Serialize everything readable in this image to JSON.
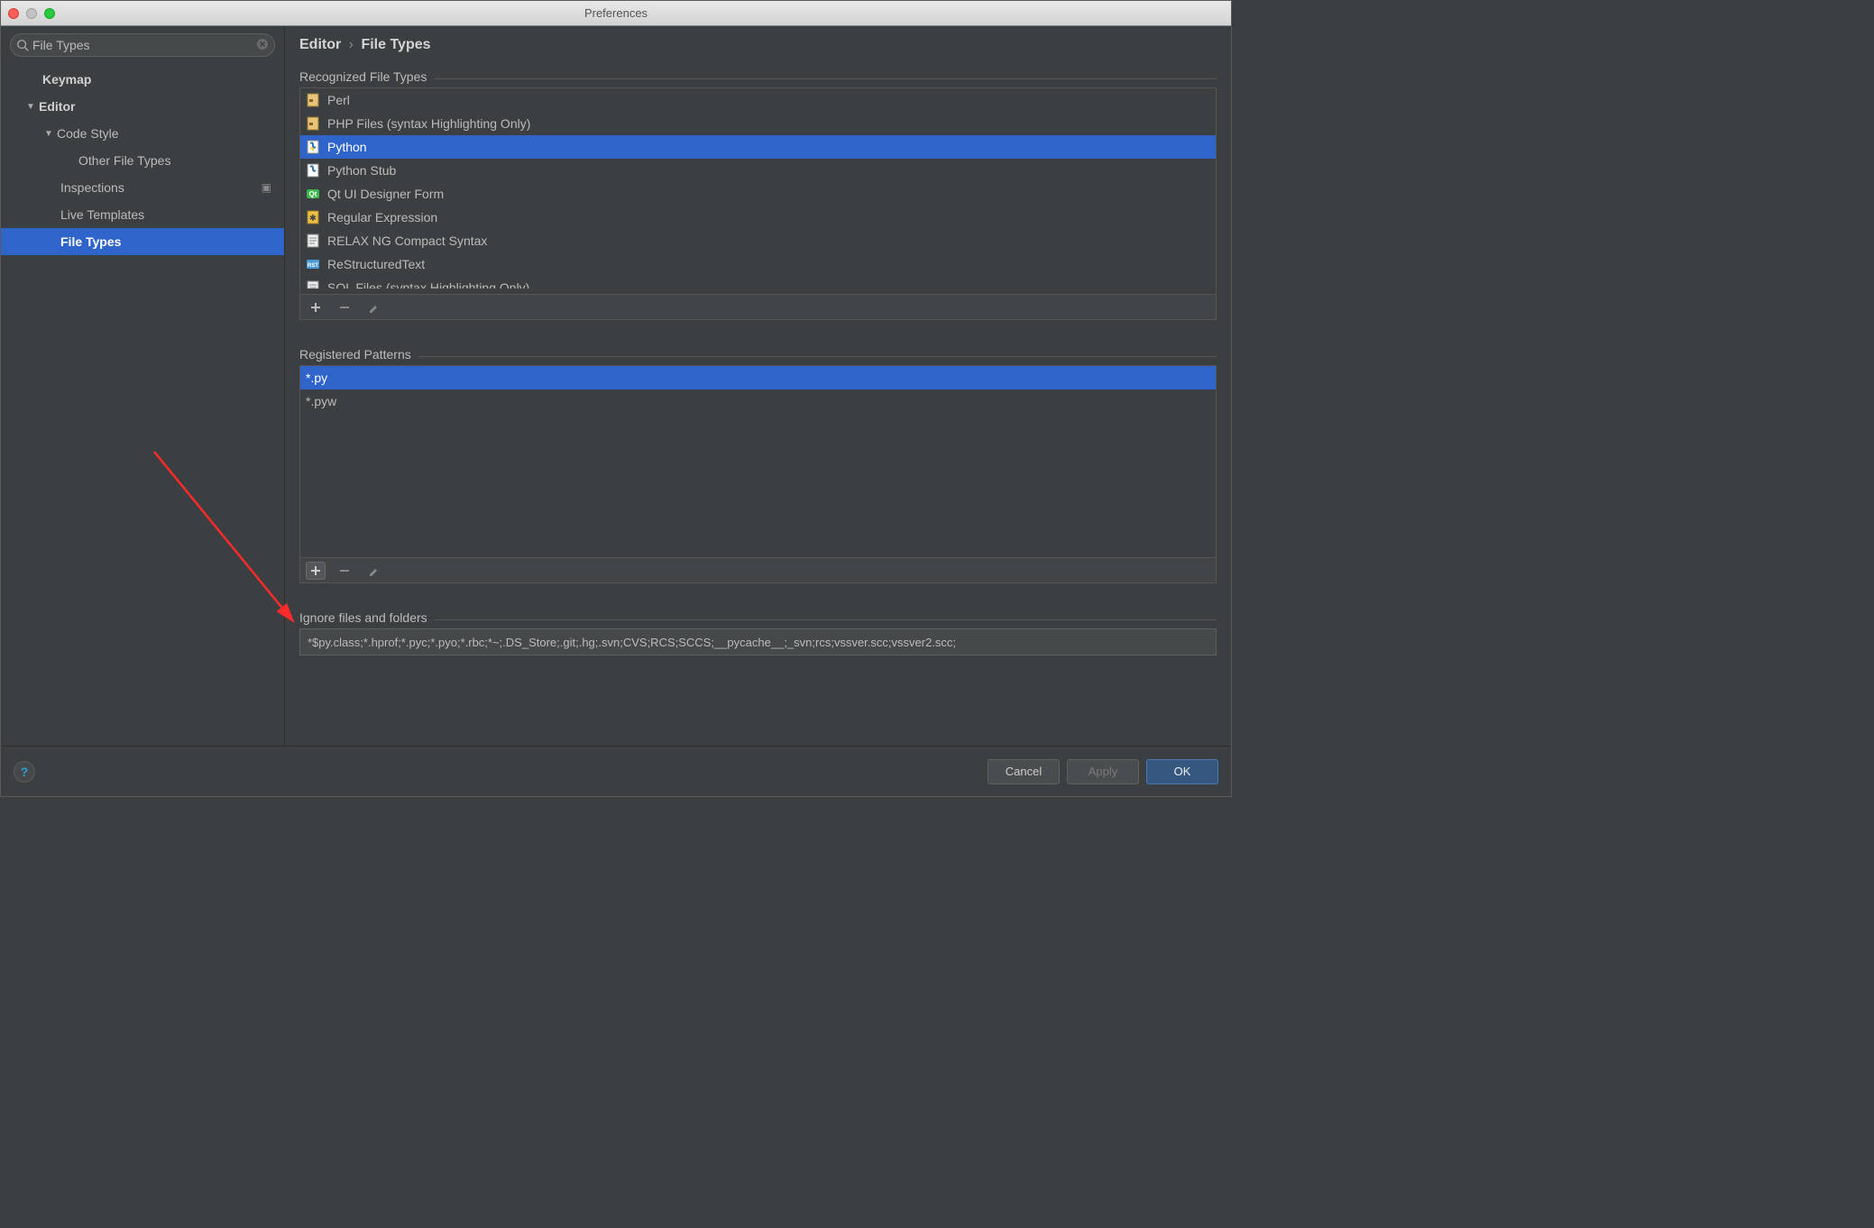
{
  "window": {
    "title": "Preferences"
  },
  "search": {
    "placeholder": "File Types"
  },
  "tree": {
    "keymap": "Keymap",
    "editor": "Editor",
    "code_style": "Code Style",
    "other_file_types": "Other File Types",
    "inspections": "Inspections",
    "live_templates": "Live Templates",
    "file_types": "File Types"
  },
  "breadcrumb": {
    "parent": "Editor",
    "current": "File Types"
  },
  "sections": {
    "recognized": "Recognized File Types",
    "patterns": "Registered Patterns",
    "ignore": "Ignore files and folders"
  },
  "file_types_list": {
    "perl": "Perl",
    "php": "PHP Files (syntax Highlighting Only)",
    "python": "Python",
    "python_stub": "Python Stub",
    "qt": "Qt UI Designer Form",
    "regex": "Regular Expression",
    "relax": "RELAX NG Compact Syntax",
    "rst": "ReStructuredText",
    "sql": "SQL Files (syntax Highlighting Only)"
  },
  "patterns_list": {
    "py": "*.py",
    "pyw": "*.pyw"
  },
  "ignore_value": "*$py.class;*.hprof;*.pyc;*.pyo;*.rbc;*~;.DS_Store;.git;.hg;.svn;CVS;RCS;SCCS;__pycache__;_svn;rcs;vssver.scc;vssver2.scc;",
  "buttons": {
    "cancel": "Cancel",
    "apply": "Apply",
    "ok": "OK"
  }
}
